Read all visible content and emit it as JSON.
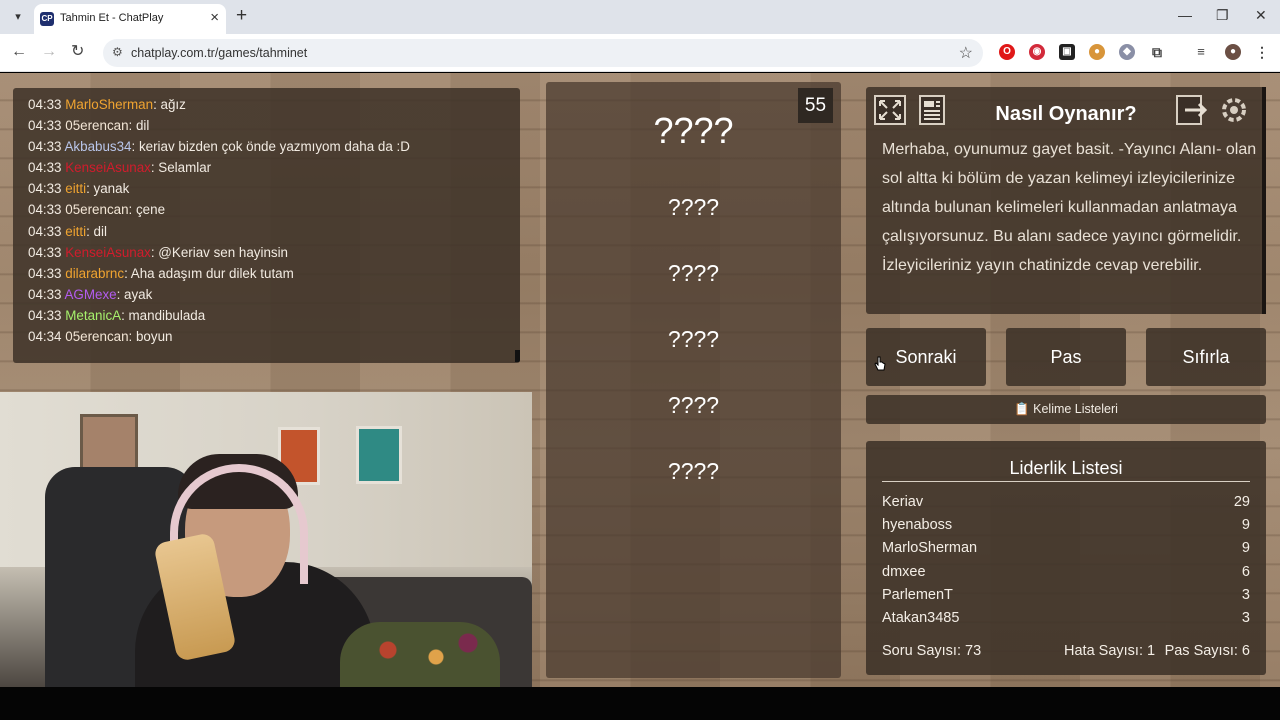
{
  "browser": {
    "tab_title": "Tahmin Et - ChatPlay",
    "favicon_text": "CP",
    "url": "chatplay.com.tr/games/tahminet",
    "icons": [
      "chevron-down-icon",
      "close-icon",
      "plus-icon",
      "minimize-icon",
      "restore-icon",
      "close-window-icon",
      "back-icon",
      "forward-icon",
      "reload-icon",
      "site-info-icon",
      "star-icon",
      "opera-icon",
      "extension-icon",
      "puzzle-icon",
      "media-icon",
      "profile-icon",
      "kebab-menu-icon"
    ]
  },
  "chat": {
    "messages": [
      {
        "time": "04:33",
        "user": "MarloSherman",
        "color": "#f0a430",
        "text": ": ağız"
      },
      {
        "time": "04:33",
        "user": "05erencan",
        "color": "#f3e6d6",
        "text": ": dil"
      },
      {
        "time": "04:33",
        "user": "Akbabus34",
        "color": "#b9c6ea",
        "text": ": keriav bizden çok önde yazmıyom daha da :D"
      },
      {
        "time": "04:33",
        "user": "KenseiAsunax",
        "color": "#d11c2c",
        "text": ": Selamlar"
      },
      {
        "time": "04:33",
        "user": "eitti",
        "color": "#f0a430",
        "text": ": yanak"
      },
      {
        "time": "04:33",
        "user": "05erencan",
        "color": "#f3e6d6",
        "text": ": çene"
      },
      {
        "time": "04:33",
        "user": "eitti",
        "color": "#f0a430",
        "text": ": dil"
      },
      {
        "time": "04:33",
        "user": "KenseiAsunax",
        "color": "#d11c2c",
        "text": ": @Keriav sen hayinsin"
      },
      {
        "time": "04:33",
        "user": "dilarabrnc",
        "color": "#f0a430",
        "text": ": Aha adaşım dur dilek tutam"
      },
      {
        "time": "04:33",
        "user": "AGMexe",
        "color": "#b35cf0",
        "text": ": ayak"
      },
      {
        "time": "04:33",
        "user": "MetanicA",
        "color": "#a6f06c",
        "text": ": mandibulada"
      },
      {
        "time": "04:34",
        "user": "05erencan",
        "color": "#f3e6d6",
        "text": ": boyun"
      }
    ]
  },
  "game": {
    "timer": "55",
    "main_word": "????",
    "taboo_words": [
      "????",
      "????",
      "????",
      "????",
      "????"
    ]
  },
  "howto": {
    "title": "Nasıl Oynanır?",
    "text": "Merhaba, oyunumuz gayet basit. -Yayıncı Alanı- olan sol altta ki bölüm de yazan kelimeyi izleyicilerinize altında bulunan kelimeleri kullanmadan anlatmaya çalışıyorsunuz. Bu alanı sadece yayıncı görmelidir. İzleyicileriniz yayın chatinizde cevap verebilir."
  },
  "actions": {
    "next": "Sonraki",
    "pass": "Pas",
    "reset": "Sıfırla",
    "word_lists": "📋 Kelime Listeleri"
  },
  "leaderboard": {
    "title": "Liderlik Listesi",
    "rows": [
      {
        "name": "Keriav",
        "score": "29"
      },
      {
        "name": "hyenaboss",
        "score": "9"
      },
      {
        "name": "MarloSherman",
        "score": "9"
      },
      {
        "name": "dmxee",
        "score": "6"
      },
      {
        "name": "ParlemenT",
        "score": "3"
      },
      {
        "name": "Atakan3485",
        "score": "3"
      }
    ],
    "questions": "Soru Sayısı: 73",
    "errors": "Hata Sayısı: 1",
    "passes": "Pas Sayısı: 6"
  }
}
